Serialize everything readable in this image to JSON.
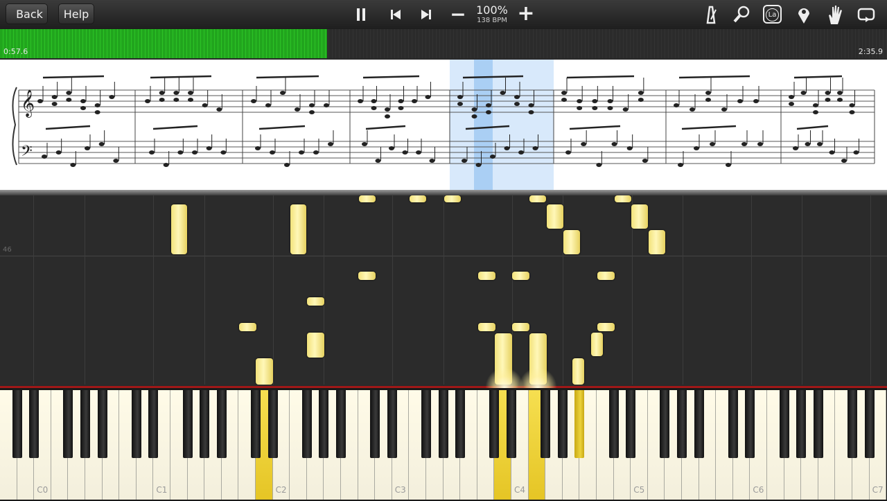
{
  "toolbar": {
    "back_label": "Back",
    "help_label": "Help",
    "zoom": "100%",
    "tempo": "138 BPM",
    "pause_icon": "pause-icon",
    "prev_icon": "skip-back-icon",
    "next_icon": "skip-forward-icon",
    "minus": "−",
    "plus": "+",
    "note_label_badge": "La",
    "right_icons": [
      "metronome-icon",
      "magnifier-icon",
      "note-labels-icon",
      "location-pin-icon",
      "hand-icon",
      "loop-icon"
    ]
  },
  "progress": {
    "elapsed": "0:57.6",
    "total": "2:35.9",
    "fraction": 0.369,
    "fill_color": "#2cc426"
  },
  "piano_roll": {
    "measure_number": "46",
    "note_color": "#f5e27a"
  },
  "keyboard": {
    "octave_labels": [
      "C0",
      "C1",
      "C2",
      "C3",
      "C4",
      "C5",
      "C6",
      "C7"
    ]
  }
}
